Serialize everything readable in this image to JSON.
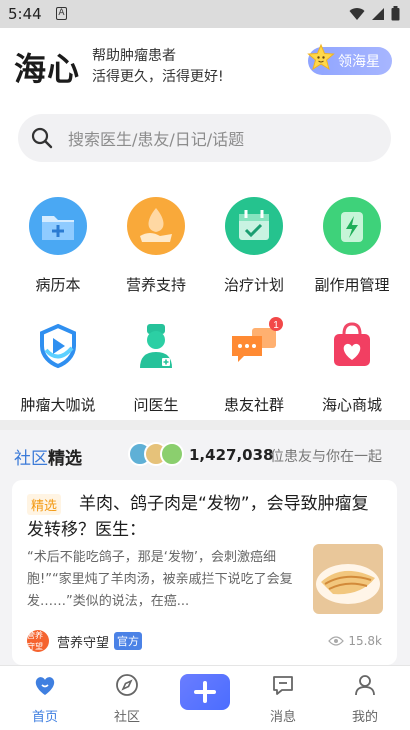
{
  "status": {
    "time": "5:44",
    "a_icon": "A"
  },
  "header": {
    "logo": "海心",
    "slogan_line1": "帮助肿瘤患者",
    "slogan_line2": "活得更久，活得更好!",
    "star_button": "领海星"
  },
  "search": {
    "placeholder": "搜索医生/患友/日记/话题"
  },
  "features": [
    {
      "label": "病历本",
      "icon": "folder-plus-icon"
    },
    {
      "label": "营养支持",
      "icon": "nutrition-hand-icon"
    },
    {
      "label": "治疗计划",
      "icon": "calendar-check-icon"
    },
    {
      "label": "副作用管理",
      "icon": "battery-bolt-icon"
    },
    {
      "label": "肿瘤大咖说",
      "icon": "play-shield-icon"
    },
    {
      "label": "问医生",
      "icon": "doctor-icon"
    },
    {
      "label": "患友社群",
      "icon": "chat-bubbles-icon",
      "badge": "1"
    },
    {
      "label": "海心商城",
      "icon": "shopping-bag-heart-icon"
    }
  ],
  "community": {
    "title_blue": "社区",
    "title_bold": "精选",
    "count": "1,427,038",
    "count_text": "位患友与你在一起"
  },
  "article": {
    "tag": "精选",
    "title": "羊肉、鸽子肉是“发物”，会导致肿瘤复发转移？医生：",
    "excerpt": "“术后不能吃鸽子，那是‘发物’，会刺激癌细胞!”“家里炖了羊肉汤，被亲戚拦下说吃了会复发……”类似的说法，在癌...",
    "author": "营养守望",
    "author_avatar_text": "营养守望",
    "official_badge": "官方",
    "views": "15.8k"
  },
  "tabbar": {
    "home": "首页",
    "community": "社区",
    "messages": "消息",
    "mine": "我的"
  },
  "colors": {
    "accent": "#3f7fe0",
    "tag_orange": "#f39a14",
    "star_purple": "#9aaeff"
  }
}
